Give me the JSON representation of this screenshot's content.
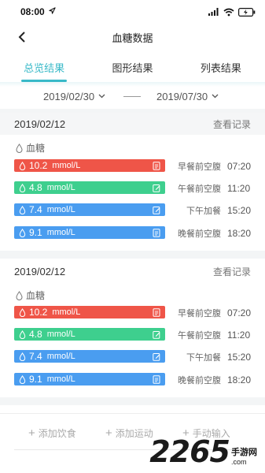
{
  "status_bar": {
    "time": "08:00",
    "battery": "54"
  },
  "header": {
    "title": "血糖数据"
  },
  "tabs": [
    {
      "label": "总览结果",
      "active": true
    },
    {
      "label": "图形结果",
      "active": false
    },
    {
      "label": "列表结果",
      "active": false
    }
  ],
  "date_range": {
    "start": "2019/02/30",
    "end": "2019/07/30"
  },
  "sections": [
    {
      "date": "2019/02/12",
      "view_label": "查看记录",
      "category": "血糖",
      "readings": [
        {
          "value": "10.2",
          "unit": "mmol/L",
          "meal": "早餐前空腹",
          "time": "07:20",
          "color": "#ef5548",
          "icon": "document-icon"
        },
        {
          "value": "4.8",
          "unit": "mmol/L",
          "meal": "午餐前空腹",
          "time": "11:20",
          "color": "#3ecf8e",
          "icon": "edit-icon"
        },
        {
          "value": "7.4",
          "unit": "mmol/L",
          "meal": "下午加餐",
          "time": "15:20",
          "color": "#4a9df0",
          "icon": "edit-icon"
        },
        {
          "value": "9.1",
          "unit": "mmol/L",
          "meal": "晚餐前空腹",
          "time": "18:20",
          "color": "#4a9df0",
          "icon": "document-icon"
        }
      ]
    },
    {
      "date": "2019/02/12",
      "view_label": "查看记录",
      "category": "血糖",
      "readings": [
        {
          "value": "10.2",
          "unit": "mmol/L",
          "meal": "早餐前空腹",
          "time": "07:20",
          "color": "#ef5548",
          "icon": "document-icon"
        },
        {
          "value": "4.8",
          "unit": "mmol/L",
          "meal": "午餐前空腹",
          "time": "11:20",
          "color": "#3ecf8e",
          "icon": "edit-icon"
        },
        {
          "value": "7.4",
          "unit": "mmol/L",
          "meal": "下午加餐",
          "time": "15:20",
          "color": "#4a9df0",
          "icon": "edit-icon"
        },
        {
          "value": "9.1",
          "unit": "mmol/L",
          "meal": "晚餐前空腹",
          "time": "18:20",
          "color": "#4a9df0",
          "icon": "document-icon"
        }
      ]
    }
  ],
  "bottom_actions": [
    {
      "label": "添加饮食"
    },
    {
      "label": "添加运动"
    },
    {
      "label": "手动输入"
    }
  ],
  "watermark": {
    "number": "2265",
    "text": "手游网",
    "domain": ".com"
  },
  "accent_color": "#38b9c8"
}
